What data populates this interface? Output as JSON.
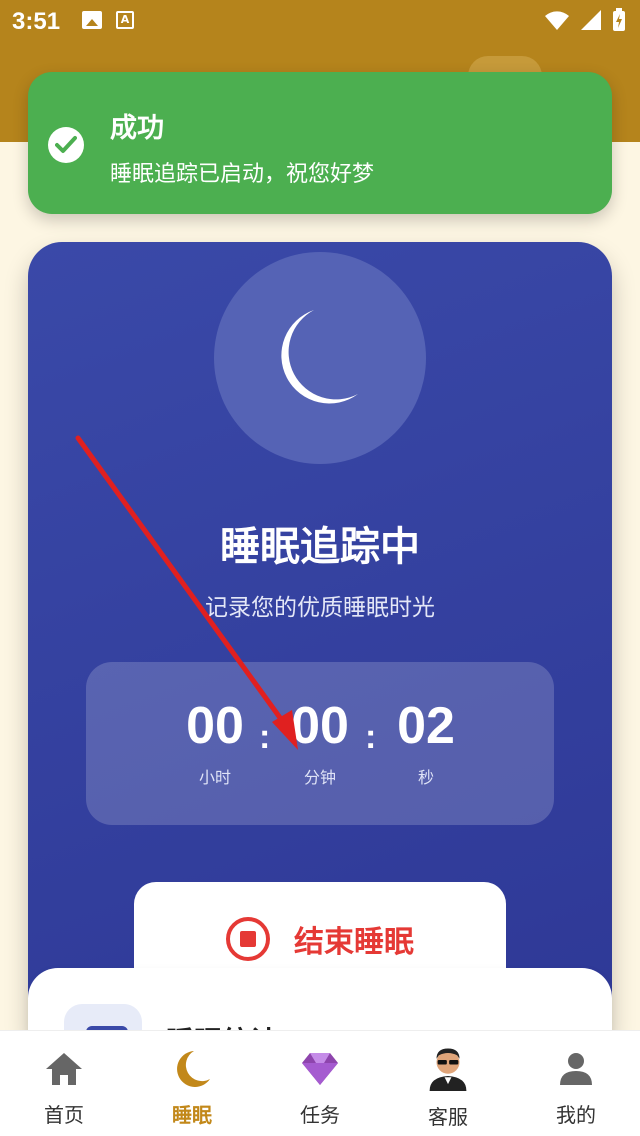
{
  "status_bar": {
    "time": "3:51",
    "icons": [
      "image-icon",
      "text-a-icon",
      "wifi-icon",
      "signal-icon",
      "battery-charging-icon"
    ]
  },
  "toast": {
    "title": "成功",
    "message": "睡眠追踪已启动，祝您好梦",
    "color": "#4caf50"
  },
  "sleep_card": {
    "title": "睡眠追踪中",
    "subtitle": "记录您的优质睡眠时光",
    "timer": {
      "hours": "00",
      "minutes": "00",
      "seconds": "02",
      "hours_label": "小时",
      "minutes_label": "分钟",
      "seconds_label": "秒",
      "separator": ":"
    },
    "end_button_label": "结束睡眠",
    "colors": {
      "card": "#3a49a8",
      "end_button_text": "#e53935"
    }
  },
  "lower_card": {
    "title": "睡眠统计"
  },
  "bottom_nav": {
    "items": [
      {
        "label": "首页",
        "icon": "home-icon",
        "active": false
      },
      {
        "label": "睡眠",
        "icon": "moon-icon",
        "active": true
      },
      {
        "label": "任务",
        "icon": "diamond-icon",
        "active": false
      },
      {
        "label": "客服",
        "icon": "agent-avatar-icon",
        "active": false
      },
      {
        "label": "我的",
        "icon": "person-icon",
        "active": false
      }
    ],
    "active_color": "#c2881a"
  },
  "annotation": {
    "arrow_color": "#e02020"
  }
}
